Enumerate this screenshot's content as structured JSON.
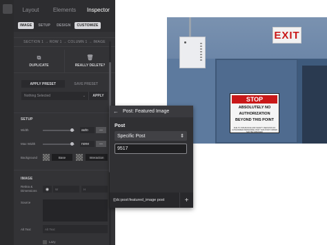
{
  "inspector": {
    "tabs": [
      {
        "label": "Layout",
        "active": false
      },
      {
        "label": "Elements",
        "active": false
      },
      {
        "label": "Inspector",
        "active": true
      }
    ],
    "subtabs": [
      {
        "label": "IMAGE",
        "active": true
      },
      {
        "label": "SETUP",
        "active": false
      },
      {
        "label": "DESIGN",
        "active": false
      },
      {
        "label": "CUSTOMIZE",
        "active": true
      }
    ],
    "breadcrumb": "SECTION 1 → ROW 1 → COLUMN 1 → IMAGE",
    "actions": {
      "duplicate": "DUPLICATE",
      "delete": "REALLY DELETE?"
    },
    "presets": {
      "apply_label": "APPLY PRESET",
      "save_label": "SAVE PRESET",
      "select_value": "Nothing Selected",
      "apply_button": "APPLY"
    },
    "setup": {
      "title": "SETUP",
      "width_label": "Width",
      "width_value": "auto",
      "max_width_label": "Max Width",
      "max_width_value": "none",
      "background_label": "Background",
      "base_label": "Base",
      "interaction_label": "Interaction",
      "minus_label": "—"
    },
    "image": {
      "title": "IMAGE",
      "retina_label": "Retina & Dimensions",
      "width_placeholder": "W",
      "height_placeholder": "H",
      "source_label": "Source",
      "alt_label": "Alt Text",
      "alt_placeholder": "Alt Text",
      "lazy_label": "Lazy"
    }
  },
  "popover": {
    "title": "Post: Featured Image",
    "post_label": "Post",
    "post_select": "Specific Post",
    "post_id": "9517",
    "dynamic_tag": "{{dc:post:featured_image post"
  },
  "photo": {
    "exit_sign": "EXIT",
    "stop_title": "STOP",
    "stop_line1": "ABSOLUTELY NO",
    "stop_line2": "AUTHORIZATION",
    "stop_line3": "BEYOND THIS POINT",
    "stop_fine": "DUE TO INSURANCE AND SAFETY REASONS NO AUTHORIZED PERSONNEL PAST THIS POINT ORDER MAY BE DAMAGED"
  },
  "colors": {
    "panel_bg": "#333336",
    "popover_bg": "#303033",
    "exit_red": "#c91818"
  }
}
